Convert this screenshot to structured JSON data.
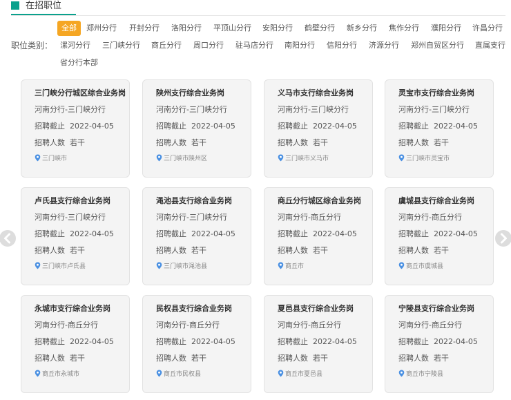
{
  "header": {
    "title": "在招职位",
    "accent_color": "#0aa18d"
  },
  "filter": {
    "label": "职位类别：",
    "active_color": "#f5a623",
    "chips": [
      "全部",
      "郑州分行",
      "开封分行",
      "洛阳分行",
      "平顶山分行",
      "安阳分行",
      "鹤壁分行",
      "新乡分行",
      "焦作分行",
      "濮阳分行",
      "许昌分行",
      "漯河分行",
      "三门峡分行",
      "商丘分行",
      "周口分行",
      "驻马店分行",
      "南阳分行",
      "信阳分行",
      "济源分行",
      "郑州自贸区分行",
      "直属支行",
      "省分行本部"
    ]
  },
  "jobs": [
    {
      "title": "三门峡分行城区综合业务岗",
      "branch": "河南分行-三门峡分行",
      "deadline_label": "招聘截止",
      "deadline": "2022-04-05",
      "count_label": "招聘人数",
      "count": "若干",
      "location": "三门峡市"
    },
    {
      "title": "陕州支行综合业务岗",
      "branch": "河南分行-三门峡分行",
      "deadline_label": "招聘截止",
      "deadline": "2022-04-05",
      "count_label": "招聘人数",
      "count": "若干",
      "location": "三门峡市陕州区"
    },
    {
      "title": "义马市支行综合业务岗",
      "branch": "河南分行-三门峡分行",
      "deadline_label": "招聘截止",
      "deadline": "2022-04-05",
      "count_label": "招聘人数",
      "count": "若干",
      "location": "三门峡市义马市"
    },
    {
      "title": "灵宝市支行综合业务岗",
      "branch": "河南分行-三门峡分行",
      "deadline_label": "招聘截止",
      "deadline": "2022-04-05",
      "count_label": "招聘人数",
      "count": "若干",
      "location": "三门峡市灵宝市"
    },
    {
      "title": "卢氏县支行综合业务岗",
      "branch": "河南分行-三门峡分行",
      "deadline_label": "招聘截止",
      "deadline": "2022-04-05",
      "count_label": "招聘人数",
      "count": "若干",
      "location": "三门峡市卢氏县"
    },
    {
      "title": "渑池县支行综合业务岗",
      "branch": "河南分行-三门峡分行",
      "deadline_label": "招聘截止",
      "deadline": "2022-04-05",
      "count_label": "招聘人数",
      "count": "若干",
      "location": "三门峡市渑池县"
    },
    {
      "title": "商丘分行城区综合业务岗",
      "branch": "河南分行-商丘分行",
      "deadline_label": "招聘截止",
      "deadline": "2022-04-05",
      "count_label": "招聘人数",
      "count": "若干",
      "location": "商丘市"
    },
    {
      "title": "虞城县支行综合业务岗",
      "branch": "河南分行-商丘分行",
      "deadline_label": "招聘截止",
      "deadline": "2022-04-05",
      "count_label": "招聘人数",
      "count": "若干",
      "location": "商丘市虞城县"
    },
    {
      "title": "永城市支行综合业务岗",
      "branch": "河南分行-商丘分行",
      "deadline_label": "招聘截止",
      "deadline": "2022-04-05",
      "count_label": "招聘人数",
      "count": "若干",
      "location": "商丘市永城市"
    },
    {
      "title": "民权县支行综合业务岗",
      "branch": "河南分行-商丘分行",
      "deadline_label": "招聘截止",
      "deadline": "2022-04-05",
      "count_label": "招聘人数",
      "count": "若干",
      "location": "商丘市民权县"
    },
    {
      "title": "夏邑县支行综合业务岗",
      "branch": "河南分行-商丘分行",
      "deadline_label": "招聘截止",
      "deadline": "2022-04-05",
      "count_label": "招聘人数",
      "count": "若干",
      "location": "商丘市夏邑县"
    },
    {
      "title": "宁陵县支行综合业务岗",
      "branch": "河南分行-商丘分行",
      "deadline_label": "招聘截止",
      "deadline": "2022-04-05",
      "count_label": "招聘人数",
      "count": "若干",
      "location": "商丘市宁陵县"
    }
  ]
}
